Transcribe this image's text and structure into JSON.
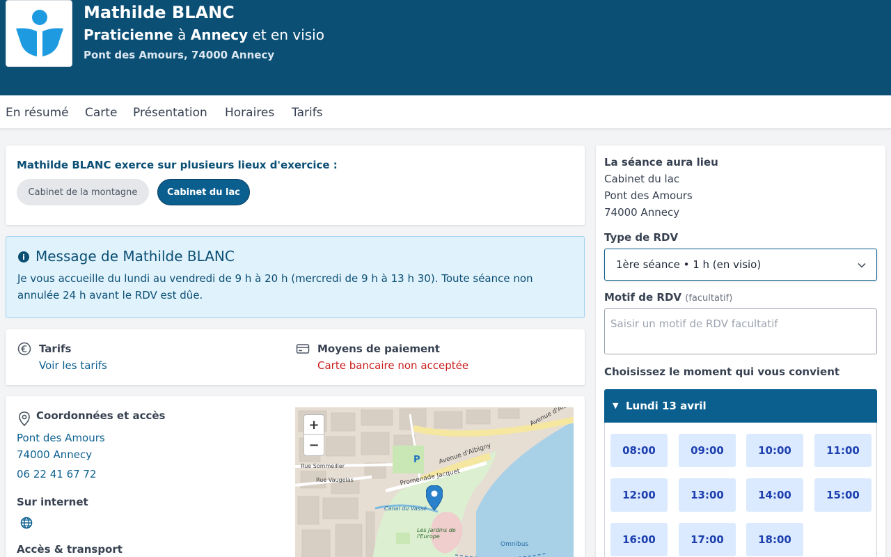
{
  "profile": {
    "name": "Mathilde BLANC",
    "role": "Praticienne",
    "at": "à",
    "city": "Annecy",
    "visio": "et en visio",
    "address": "Pont des Amours, 74000 Annecy"
  },
  "nav": {
    "items": [
      "En résumé",
      "Carte",
      "Présentation",
      "Horaires",
      "Tarifs"
    ]
  },
  "places": {
    "title": "Mathilde BLANC exerce sur plusieurs lieux d'exercice :",
    "options": [
      "Cabinet de la montagne",
      "Cabinet du lac"
    ],
    "selected": "Cabinet du lac"
  },
  "message": {
    "title": "Message de Mathilde BLANC",
    "body": "Je vous accueille du lundi au vendredi de 9 h à 20 h (mercredi de 9 h à 13 h 30). Toute séance non annulée 24 h avant le RDV est dûe."
  },
  "pricing": {
    "title": "Tarifs",
    "link": "Voir les tarifs",
    "payment_title": "Moyens de paiement",
    "payment_value": "Carte bancaire non acceptée"
  },
  "contact": {
    "title": "Coordonnées et accès",
    "street": "Pont des Amours",
    "city": "74000 Annecy",
    "phone": "06 22 41 67 72",
    "internet_title": "Sur internet",
    "access_title": "Accès & transport"
  },
  "map": {
    "zoom_in": "+",
    "zoom_out": "−",
    "labels": [
      "Avenue d'Albigny",
      "Promenade Jacquet",
      "Rue Sommeiller",
      "Rue Vaugelas",
      "Canal du Vassé",
      "Les Jardins de l'Europe",
      "Omnibus",
      "Avenue d'Alb"
    ]
  },
  "booking": {
    "place_title": "La séance aura lieu",
    "place_name": "Cabinet du lac",
    "place_street": "Pont des Amours",
    "place_city": "74000 Annecy",
    "type_label": "Type de RDV",
    "type_value": "1ère séance • 1 h (en visio)",
    "motif_label": "Motif de RDV",
    "motif_optional": "(facultatif)",
    "motif_placeholder": "Saisir un motif de RDV facultatif",
    "choose_label": "Choisissez le moment qui vous convient",
    "day_label": "Lundi 13 avril",
    "slots": [
      "08:00",
      "09:00",
      "10:00",
      "11:00",
      "12:00",
      "13:00",
      "14:00",
      "15:00",
      "16:00",
      "17:00",
      "18:00"
    ]
  },
  "colors": {
    "header_bg": "#0b4f75",
    "accent": "#0b5f8f",
    "slot_bg": "#dbeafe",
    "error": "#c81e1e",
    "info_bg": "#e0f2fb"
  }
}
